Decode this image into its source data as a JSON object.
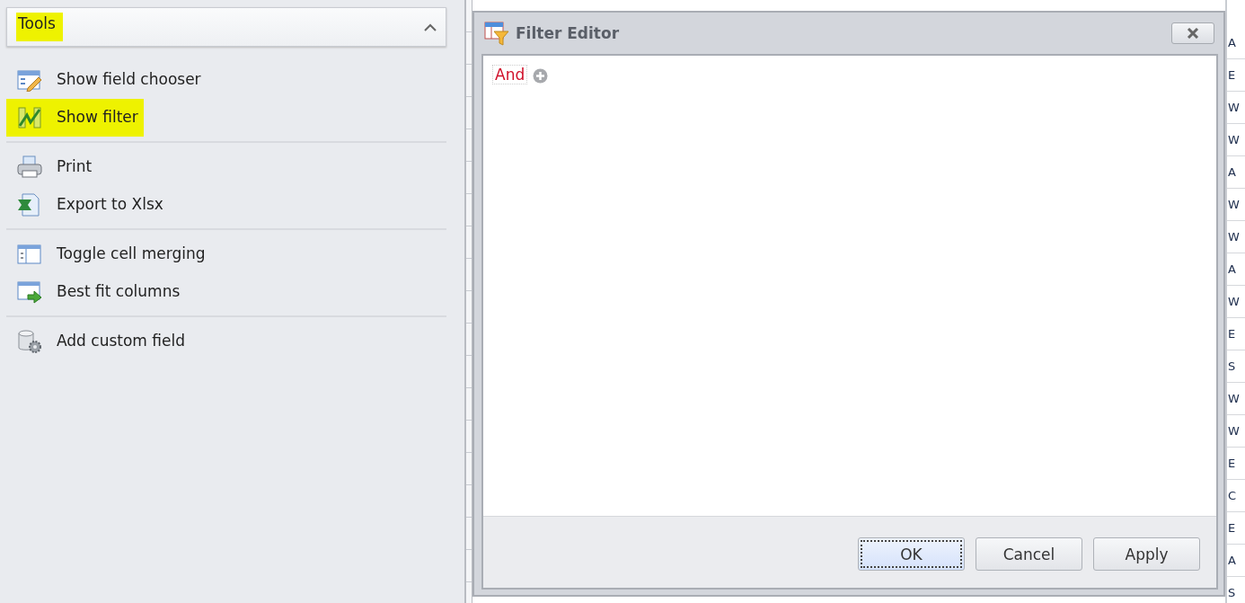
{
  "tools_panel": {
    "title": "Tools",
    "title_highlighted": true,
    "expanded": true,
    "groups": [
      [
        {
          "label": "Show field chooser",
          "highlighted": false
        },
        {
          "label": "Show filter",
          "highlighted": true
        }
      ],
      [
        {
          "label": "Print",
          "highlighted": false
        },
        {
          "label": "Export to Xlsx",
          "highlighted": false
        }
      ],
      [
        {
          "label": "Toggle cell merging",
          "highlighted": false
        },
        {
          "label": "Best fit columns",
          "highlighted": false
        }
      ],
      [
        {
          "label": "Add custom field",
          "highlighted": false
        }
      ]
    ]
  },
  "filter_editor": {
    "title": "Filter Editor",
    "root_operator": "And",
    "buttons": [
      {
        "label": "OK",
        "focused": true
      },
      {
        "label": "Cancel",
        "focused": false
      },
      {
        "label": "Apply",
        "focused": false
      }
    ]
  },
  "grid": {
    "column_1": [
      "A",
      "E",
      "W",
      "W",
      "A",
      "W",
      "W",
      "A",
      "W",
      "E",
      "S",
      "W",
      "W",
      "E",
      "C",
      "E",
      "A",
      "S"
    ]
  }
}
